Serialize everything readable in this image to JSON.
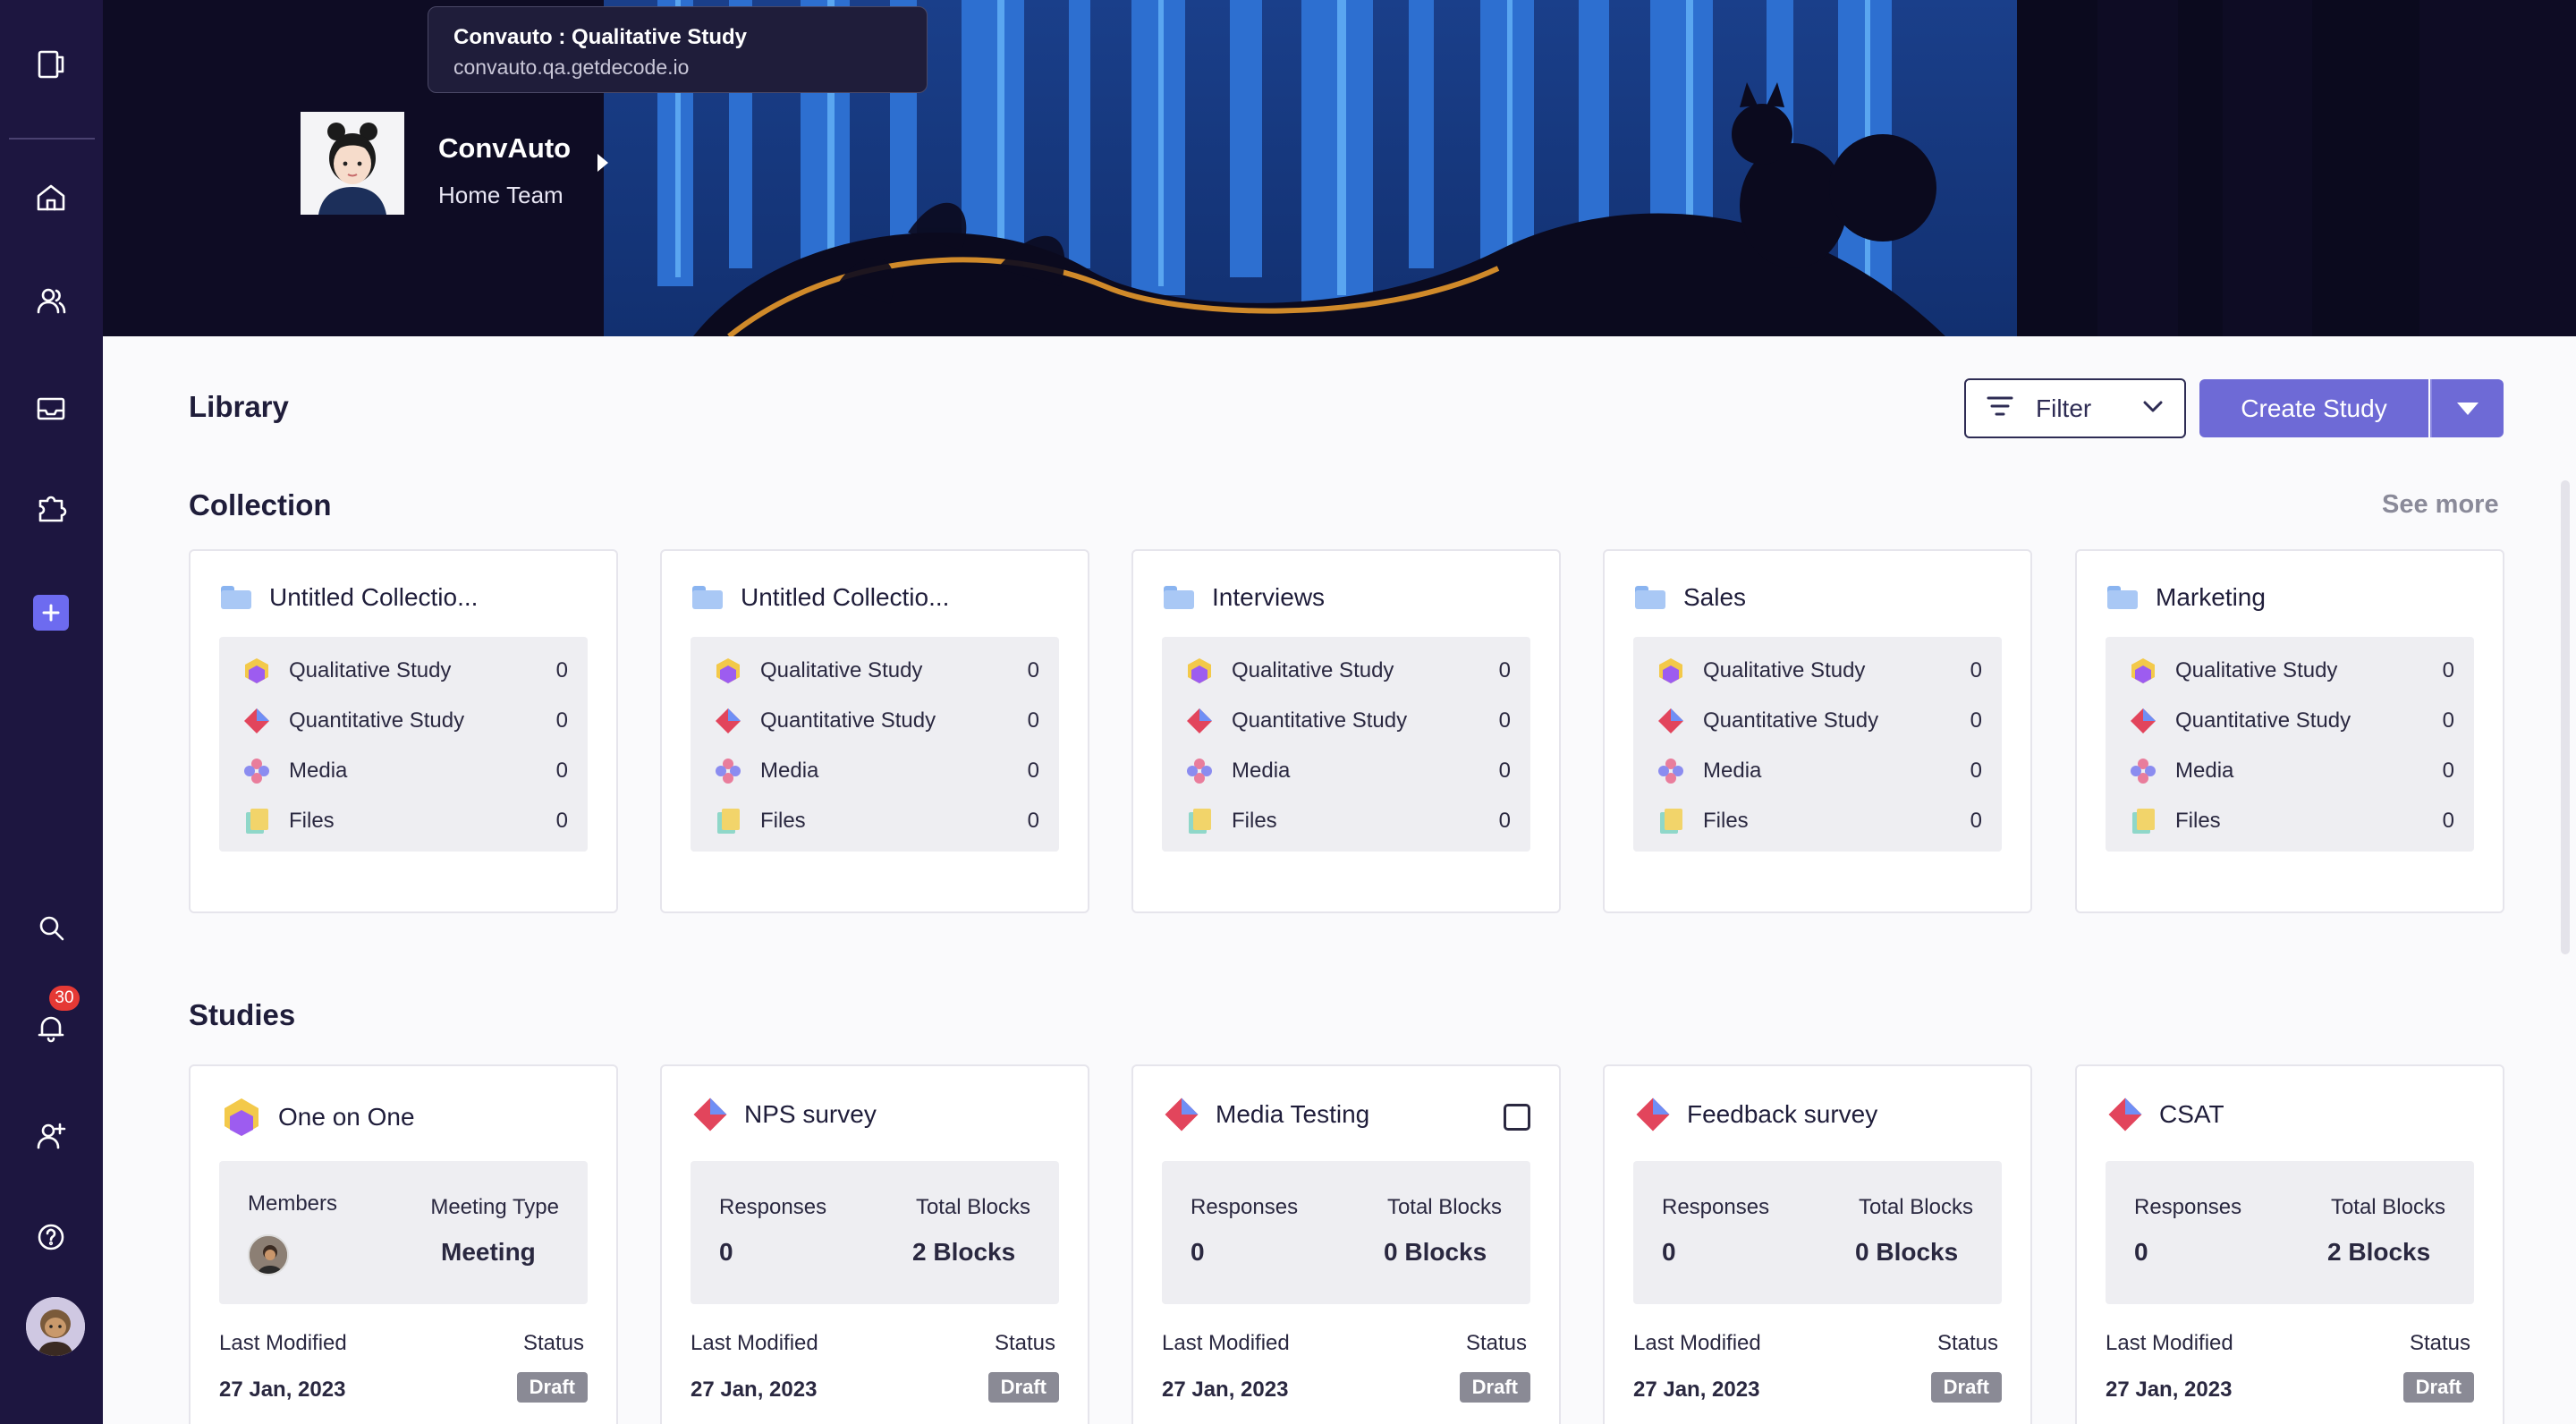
{
  "tooltip": {
    "title": "Convauto : Qualitative Study",
    "url": "convauto.qa.getdecode.io"
  },
  "profile": {
    "name": "ConvAuto",
    "team": "Home Team"
  },
  "sidebar": {
    "items": [
      {
        "icon": "document-icon"
      },
      {
        "icon": "home-icon"
      },
      {
        "icon": "users-icon"
      },
      {
        "icon": "inbox-icon"
      },
      {
        "icon": "puzzle-icon"
      },
      {
        "icon": "add-icon"
      },
      {
        "icon": "search-icon"
      },
      {
        "icon": "bell-icon"
      },
      {
        "icon": "add-user-icon"
      },
      {
        "icon": "help-icon"
      }
    ],
    "notification_count": "30"
  },
  "library": {
    "title": "Library",
    "filter_label": "Filter",
    "create_label": "Create Study"
  },
  "collections": {
    "title": "Collection",
    "see_more": "See more",
    "cards": [
      {
        "name": "Untitled Collectio...",
        "rows": [
          {
            "label": "Qualitative Study",
            "count": "0"
          },
          {
            "label": "Quantitative Study",
            "count": "0"
          },
          {
            "label": "Media",
            "count": "0"
          },
          {
            "label": "Files",
            "count": "0"
          }
        ]
      },
      {
        "name": "Untitled Collectio...",
        "rows": [
          {
            "label": "Qualitative Study",
            "count": "0"
          },
          {
            "label": "Quantitative Study",
            "count": "0"
          },
          {
            "label": "Media",
            "count": "0"
          },
          {
            "label": "Files",
            "count": "0"
          }
        ]
      },
      {
        "name": "Interviews",
        "rows": [
          {
            "label": "Qualitative Study",
            "count": "0"
          },
          {
            "label": "Quantitative Study",
            "count": "0"
          },
          {
            "label": "Media",
            "count": "0"
          },
          {
            "label": "Files",
            "count": "0"
          }
        ]
      },
      {
        "name": "Sales",
        "rows": [
          {
            "label": "Qualitative Study",
            "count": "0"
          },
          {
            "label": "Quantitative Study",
            "count": "0"
          },
          {
            "label": "Media",
            "count": "0"
          },
          {
            "label": "Files",
            "count": "0"
          }
        ]
      },
      {
        "name": "Marketing",
        "rows": [
          {
            "label": "Qualitative Study",
            "count": "0"
          },
          {
            "label": "Quantitative Study",
            "count": "0"
          },
          {
            "label": "Media",
            "count": "0"
          },
          {
            "label": "Files",
            "count": "0"
          }
        ]
      }
    ]
  },
  "studies": {
    "title": "Studies",
    "cards": [
      {
        "name": "One on One",
        "l1": "Members",
        "r1": "Meeting Type",
        "r2": "Meeting",
        "foot_l1": "Last Modified",
        "foot_r1": "Status",
        "date": "27 Jan, 2023",
        "status": "Draft"
      },
      {
        "name": "NPS survey",
        "l1": "Responses",
        "r1": "Total Blocks",
        "l2": "0",
        "r2": "2 Blocks",
        "foot_l1": "Last Modified",
        "foot_r1": "Status",
        "date": "27 Jan, 2023",
        "status": "Draft"
      },
      {
        "name": "Media Testing",
        "l1": "Responses",
        "r1": "Total Blocks",
        "l2": "0",
        "r2": "0 Blocks",
        "foot_l1": "Last Modified",
        "foot_r1": "Status",
        "date": "27 Jan, 2023",
        "status": "Draft"
      },
      {
        "name": "Feedback survey",
        "l1": "Responses",
        "r1": "Total Blocks",
        "l2": "0",
        "r2": "0 Blocks",
        "foot_l1": "Last Modified",
        "foot_r1": "Status",
        "date": "27 Jan, 2023",
        "status": "Draft"
      },
      {
        "name": "CSAT",
        "l1": "Responses",
        "r1": "Total Blocks",
        "l2": "0",
        "r2": "2 Blocks",
        "foot_l1": "Last Modified",
        "foot_r1": "Status",
        "date": "27 Jan, 2023",
        "status": "Draft"
      }
    ]
  },
  "colors": {
    "sidebar": "#1d1640",
    "accent": "#6e6ad6",
    "draft": "#8a8a95"
  }
}
